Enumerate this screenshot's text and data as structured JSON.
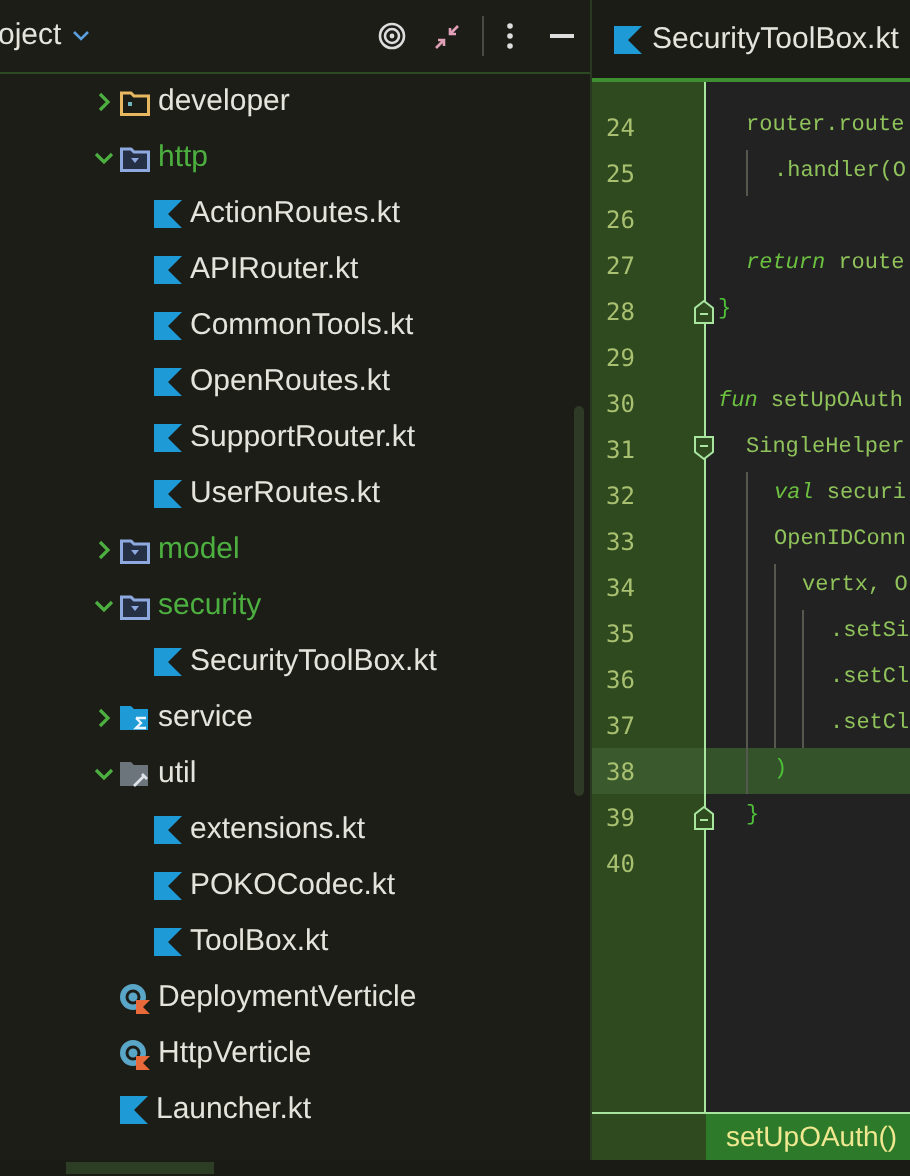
{
  "project_panel": {
    "title": "oject",
    "tree": [
      {
        "name": "developer",
        "kind": "folder",
        "expanded": false
      },
      {
        "name": "http",
        "kind": "package",
        "expanded": true,
        "children": [
          {
            "name": "ActionRoutes.kt",
            "kind": "kotlin"
          },
          {
            "name": "APIRouter.kt",
            "kind": "kotlin"
          },
          {
            "name": "CommonTools.kt",
            "kind": "kotlin"
          },
          {
            "name": "OpenRoutes.kt",
            "kind": "kotlin"
          },
          {
            "name": "SupportRouter.kt",
            "kind": "kotlin"
          },
          {
            "name": "UserRoutes.kt",
            "kind": "kotlin"
          }
        ]
      },
      {
        "name": "model",
        "kind": "package",
        "expanded": false
      },
      {
        "name": "security",
        "kind": "package",
        "expanded": true,
        "children": [
          {
            "name": "SecurityToolBox.kt",
            "kind": "kotlin"
          }
        ]
      },
      {
        "name": "service",
        "kind": "service",
        "expanded": false
      },
      {
        "name": "util",
        "kind": "tools",
        "expanded": true,
        "children": [
          {
            "name": "extensions.kt",
            "kind": "kotlin"
          },
          {
            "name": "POKOCodec.kt",
            "kind": "kotlin"
          },
          {
            "name": "ToolBox.kt",
            "kind": "kotlin"
          }
        ]
      },
      {
        "name": "DeploymentVerticle",
        "kind": "verticle"
      },
      {
        "name": "HttpVerticle",
        "kind": "verticle"
      },
      {
        "name": "Launcher.kt",
        "kind": "kotlin"
      }
    ]
  },
  "editor": {
    "tab": {
      "label": "SecurityToolBox.kt"
    },
    "lines": [
      {
        "number": "24",
        "current": false,
        "segments": [
          {
            "kind": "plain",
            "text": "  router.route"
          }
        ]
      },
      {
        "number": "25",
        "current": false,
        "segments": [
          {
            "kind": "plain",
            "text": "    .handler(O"
          }
        ]
      },
      {
        "number": "26",
        "current": false
      },
      {
        "number": "27",
        "current": false,
        "segments": [
          {
            "kind": "keyword",
            "text": "  return"
          },
          {
            "kind": "plain",
            "text": " route"
          }
        ]
      },
      {
        "number": "28",
        "current": false,
        "fold_end": true,
        "segments": [
          {
            "kind": "brace",
            "text": "}"
          }
        ]
      },
      {
        "number": "29",
        "current": false
      },
      {
        "number": "30",
        "current": false,
        "segments": [
          {
            "kind": "keyword",
            "text": "fun"
          },
          {
            "kind": "plain",
            "text": " setUpOAuth"
          }
        ]
      },
      {
        "number": "31",
        "current": false,
        "fold_start": true,
        "segments": [
          {
            "kind": "plain",
            "text": "  SingleHelper"
          }
        ]
      },
      {
        "number": "32",
        "current": false,
        "segments": [
          {
            "kind": "keyword",
            "text": "    val"
          },
          {
            "kind": "plain",
            "text": " securi"
          }
        ]
      },
      {
        "number": "33",
        "current": false,
        "segments": [
          {
            "kind": "plain",
            "text": "    OpenIDConn"
          }
        ]
      },
      {
        "number": "34",
        "current": false,
        "segments": [
          {
            "kind": "plain",
            "text": "      vertx, O"
          }
        ]
      },
      {
        "number": "35",
        "current": false,
        "segments": [
          {
            "kind": "plain",
            "text": "        .setSi"
          }
        ]
      },
      {
        "number": "36",
        "current": false,
        "segments": [
          {
            "kind": "plain",
            "text": "        .setCl"
          }
        ]
      },
      {
        "number": "37",
        "current": false,
        "segments": [
          {
            "kind": "plain",
            "text": "        .setCl"
          }
        ]
      },
      {
        "number": "38",
        "current": true,
        "segments": [
          {
            "kind": "brace",
            "text": "    )"
          }
        ]
      },
      {
        "number": "39",
        "current": false,
        "fold_end": true,
        "segments": [
          {
            "kind": "brace",
            "text": "  }"
          }
        ]
      },
      {
        "number": "40",
        "current": false
      }
    ],
    "breadcrumb": "setUpOAuth()"
  }
}
